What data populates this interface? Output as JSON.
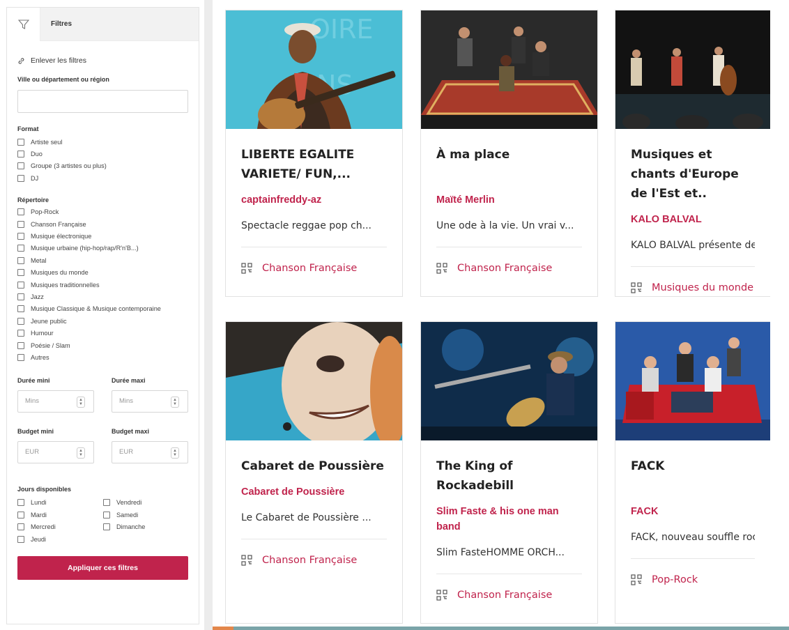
{
  "filters": {
    "title": "Filtres",
    "remove_label": "Enlever les filtres",
    "location_label": "Ville ou département ou région",
    "location_value": "",
    "format_label": "Format",
    "format_options": [
      "Artiste seul",
      "Duo",
      "Groupe (3 artistes ou plus)",
      "DJ"
    ],
    "repertoire_label": "Répertoire",
    "repertoire_options": [
      "Pop-Rock",
      "Chanson Française",
      "Musique électronique",
      "Musique urbaine (hip-hop/rap/R'n'B...)",
      "Metal",
      "Musiques du monde",
      "Musiques traditionnelles",
      "Jazz",
      "Musique Classique & Musique contemporaine",
      "Jeune public",
      "Humour",
      "Poésie / Slam",
      "Autres"
    ],
    "duree_min_label": "Durée mini",
    "duree_max_label": "Durée maxi",
    "duree_placeholder": "Mins",
    "budget_min_label": "Budget mini",
    "budget_max_label": "Budget maxi",
    "budget_placeholder": "EUR",
    "days_label": "Jours disponibles",
    "days": [
      "Lundi",
      "Vendredi",
      "Mardi",
      "Samedi",
      "Mercredi",
      "Dimanche",
      "Jeudi"
    ],
    "apply_label": "Appliquer ces filtres"
  },
  "cards": [
    {
      "title": "LIBERTE EGALITE VARIETE/ FUN,...",
      "artist": "captainfreddy-az",
      "description": "Spectacle reggae pop ch...",
      "genre": "Chanson Française",
      "image": "guitarist-photo"
    },
    {
      "title": "À ma place",
      "artist": "Maïté Merlin",
      "description": "Une ode à la vie. Un vrai v...",
      "genre": "Chanson Française",
      "image": "stage-group-photo"
    },
    {
      "title": "Musiques et chants d'Europe de l'Est et..",
      "artist": "KALO BALVAL",
      "description": "KALO BALVAL présente de",
      "genre": "Musiques du monde",
      "image": "folk-band-photo"
    },
    {
      "title": "Cabaret de Poussière",
      "artist": "Cabaret de Poussière",
      "description": "Le Cabaret de Poussière ...",
      "genre": "Chanson Française",
      "image": "cabaret-face-photo"
    },
    {
      "title": "The King of Rockadebill",
      "artist": "Slim Faste & his one man band",
      "description": "Slim FasteHOMME ORCH...",
      "genre": "Chanson Française",
      "image": "one-man-band-photo"
    },
    {
      "title": "FACK",
      "artist": "FACK",
      "description": "FACK, nouveau souffle roc",
      "genre": "Pop-Rock",
      "image": "red-sofa-band-photo"
    }
  ],
  "colors": {
    "accent": "#c0234c",
    "sidebar_header_bg": "#f2f2f2",
    "border": "#e2e2e2"
  }
}
